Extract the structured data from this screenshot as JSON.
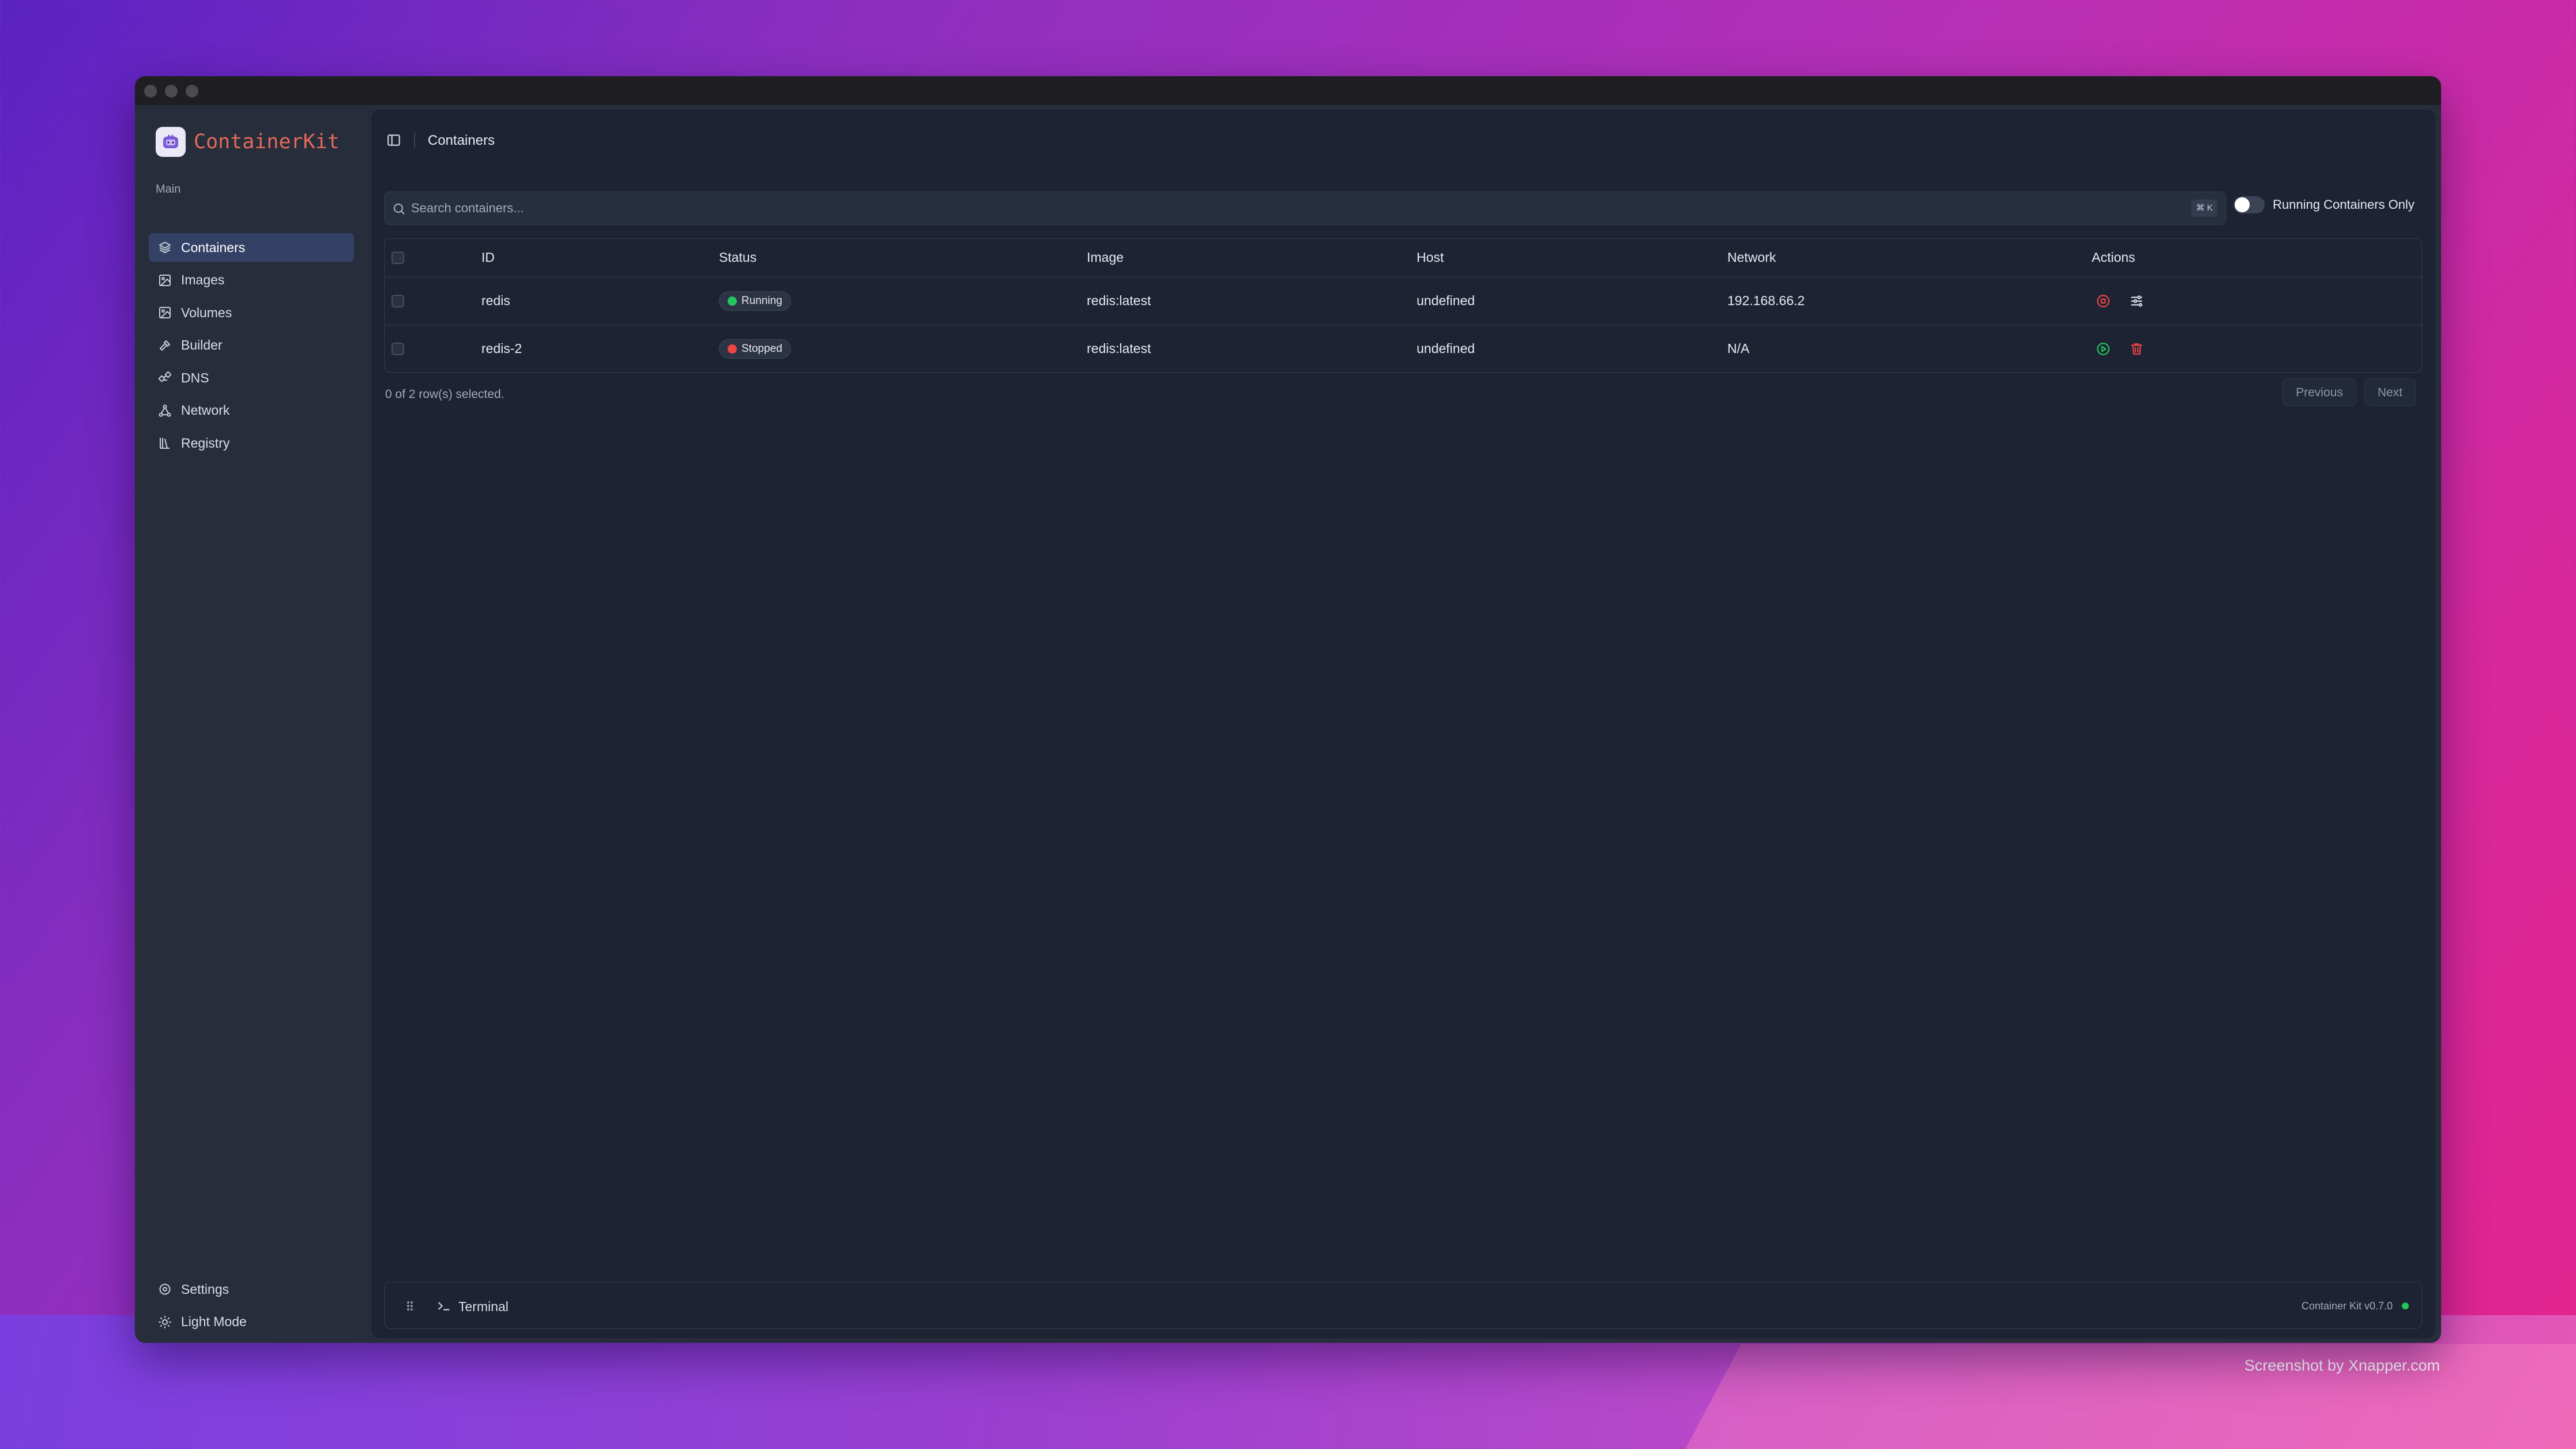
{
  "colors": {
    "brand": "#e26a5a",
    "running": "#22c55e",
    "stopped": "#ef4444",
    "sidebar_active": "#334164"
  },
  "brand": {
    "name": "ContainerKit",
    "logo_icon": "whale-box-icon"
  },
  "sidebar": {
    "section_label": "Main",
    "items": [
      {
        "label": "Containers",
        "icon": "layers-icon",
        "active": true
      },
      {
        "label": "Images",
        "icon": "image-icon"
      },
      {
        "label": "Volumes",
        "icon": "image-icon"
      },
      {
        "label": "Builder",
        "icon": "hammer-icon"
      },
      {
        "label": "DNS",
        "icon": "workflow-icon"
      },
      {
        "label": "Network",
        "icon": "network-icon"
      },
      {
        "label": "Registry",
        "icon": "library-icon"
      }
    ],
    "bottom": [
      {
        "label": "Settings",
        "icon": "gear-icon"
      },
      {
        "label": "Light Mode",
        "icon": "sun-icon"
      }
    ]
  },
  "header": {
    "title": "Containers"
  },
  "search": {
    "placeholder": "Search containers...",
    "shortcut": "⌘ K"
  },
  "filter": {
    "label": "Running Containers Only",
    "enabled": false
  },
  "table": {
    "columns": [
      "ID",
      "Status",
      "Image",
      "Host",
      "Network",
      "Actions"
    ],
    "rows": [
      {
        "id": "redis",
        "status": "Running",
        "image": "redis:latest",
        "host": "undefined",
        "network": "192.168.66.2"
      },
      {
        "id": "redis-2",
        "status": "Stopped",
        "image": "redis:latest",
        "host": "undefined",
        "network": "N/A"
      }
    ]
  },
  "footer": {
    "selection": "0 of 2 row(s) selected.",
    "previous": "Previous",
    "next": "Next"
  },
  "terminal": {
    "label": "Terminal",
    "version": "Container Kit v0.7.0"
  },
  "credit": "Screenshot by Xnapper.com"
}
